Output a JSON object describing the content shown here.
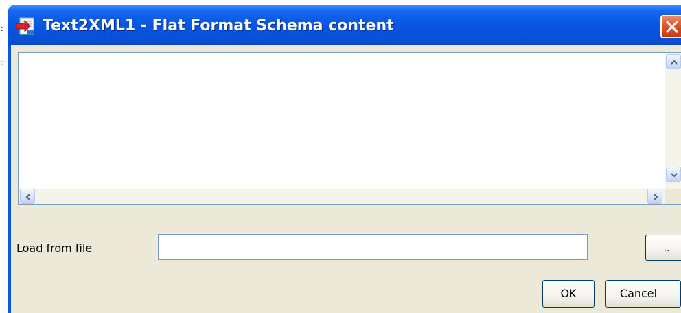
{
  "window": {
    "title": "Text2XML1 - Flat Format Schema content",
    "icons": {
      "app": "schema-app-icon",
      "close": "close-icon"
    }
  },
  "editor": {
    "content": "",
    "scroll_icons": [
      "chevron-up-icon",
      "chevron-down-icon",
      "chevron-left-icon",
      "chevron-right-icon"
    ]
  },
  "load": {
    "label": "Load from file",
    "value": "",
    "browse_label": ".."
  },
  "buttons": {
    "ok": "OK",
    "cancel": "Cancel"
  },
  "colors": {
    "titlebar": "#0a56e0",
    "close": "#e2552c",
    "client": "#ece9d8",
    "border": "#7f9db9"
  }
}
